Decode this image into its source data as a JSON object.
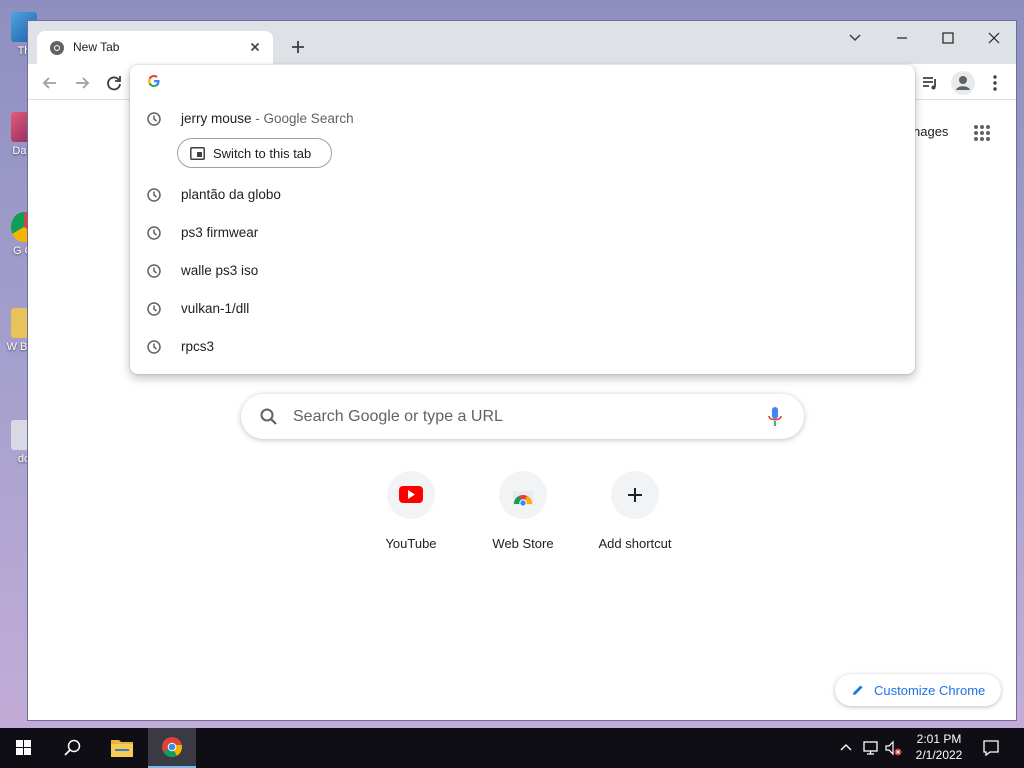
{
  "desktop": {
    "icons": [
      {
        "label": "Th"
      },
      {
        "label": "Data"
      },
      {
        "label": "G Cl"
      },
      {
        "label": "W BLU"
      },
      {
        "label": "do"
      }
    ]
  },
  "browser": {
    "tab": {
      "title": "New Tab"
    },
    "omnibox_value": ""
  },
  "dropdown": {
    "first_item": {
      "text": "jerry mouse",
      "sub": " - Google Search",
      "switch_label": "Switch to this tab"
    },
    "history": [
      {
        "text": "plantão da globo"
      },
      {
        "text": "ps3 firmwear"
      },
      {
        "text": "walle ps3 iso"
      },
      {
        "text": "vulkan-1/dll"
      },
      {
        "text": "rpcs3"
      }
    ]
  },
  "ntp": {
    "images_link": "nages",
    "search_placeholder": "Search Google or type a URL",
    "shortcuts": [
      {
        "label": "YouTube"
      },
      {
        "label": "Web Store"
      },
      {
        "label": "Add shortcut"
      }
    ],
    "customize_label": "Customize Chrome"
  },
  "taskbar": {
    "time": "2:01 PM",
    "date": "2/1/2022"
  },
  "colors": {
    "accent_blue": "#1a73e8",
    "youtube_red": "#ff0000",
    "titlebar": "#dee1e6",
    "taskbar": "#0e0e14"
  }
}
